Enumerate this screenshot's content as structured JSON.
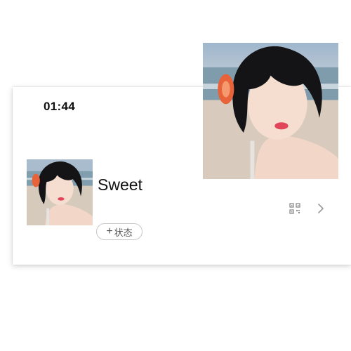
{
  "status_bar": {
    "time": "01:44"
  },
  "profile": {
    "name": "Sweet",
    "status_button": {
      "icon": "plus-icon",
      "label": "状态"
    },
    "avatar_icon": "portrait-photo",
    "right_icons": [
      "qr-code-icon",
      "chevron-right-icon"
    ]
  },
  "overlay_image": {
    "subject": "portrait-photo"
  },
  "colors": {
    "text": "#111111",
    "muted": "#555555",
    "border": "#c8c8c8",
    "sky": "#8ea5be",
    "sea": "#7e9cab",
    "sand": "#d8cbbd"
  }
}
